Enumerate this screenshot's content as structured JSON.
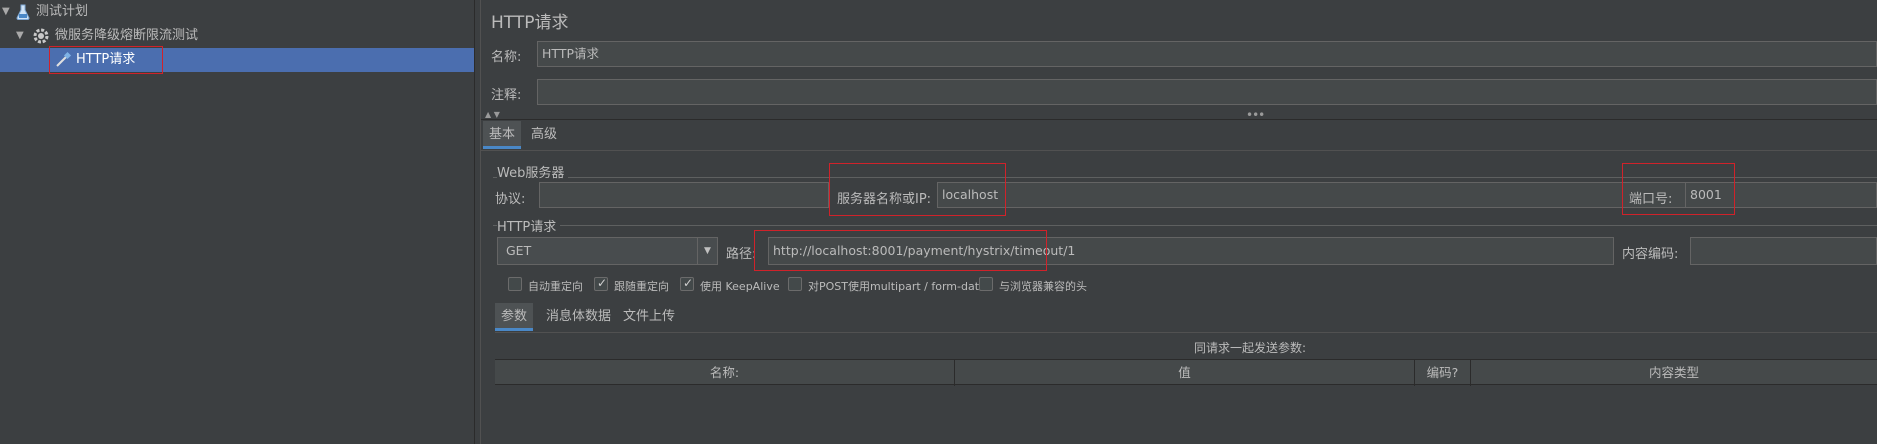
{
  "tree": {
    "items": [
      {
        "label": "测试计划",
        "icon": "flask-icon"
      },
      {
        "label": "微服务降级熔断限流测试",
        "icon": "gear-icon"
      },
      {
        "label": "HTTP请求",
        "icon": "pipette-icon"
      }
    ]
  },
  "sampler": {
    "title": "HTTP请求",
    "name_label": "名称:",
    "name_value": "HTTP请求",
    "comment_label": "注释:",
    "comment_value": "",
    "tabs": [
      "基本",
      "高级"
    ],
    "web_server": {
      "group_label": "Web服务器",
      "protocol_label": "协议:",
      "protocol_value": "",
      "server_label": "服务器名称或IP:",
      "server_value": "localhost",
      "port_label": "端口号:",
      "port_value": "8001"
    },
    "http_request": {
      "group_label": "HTTP请求",
      "method": "GET",
      "path_label": "路径:",
      "path_value": "http://localhost:8001/payment/hystrix/timeout/1",
      "encoding_label": "内容编码:",
      "encoding_value": ""
    },
    "checkboxes": [
      {
        "label": "自动重定向",
        "checked": false
      },
      {
        "label": "跟随重定向",
        "checked": true
      },
      {
        "label": "使用 KeepAlive",
        "checked": true
      },
      {
        "label": "对POST使用multipart / form-data",
        "checked": false
      },
      {
        "label": "与浏览器兼容的头",
        "checked": false
      }
    ],
    "param_tabs": [
      "参数",
      "消息体数据",
      "文件上传"
    ],
    "params_caption": "同请求一起发送参数:",
    "columns": [
      "名称:",
      "值",
      "编码?",
      "内容类型"
    ]
  },
  "colors": {
    "selection": "#4b6eaf",
    "highlight_box": "#d0222a",
    "background": "#3c3f41"
  }
}
